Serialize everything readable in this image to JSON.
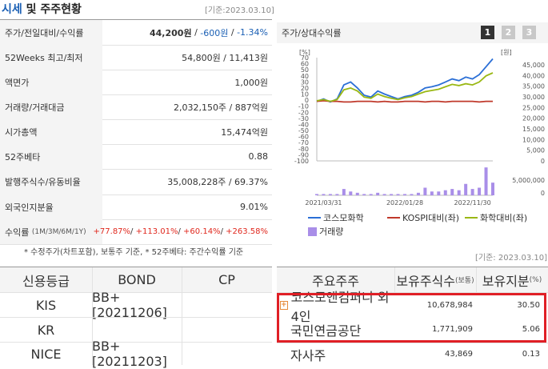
{
  "header": {
    "title_main": "시세",
    "title_rest": " 및 주주현황",
    "basis": "[기준:2023.03.10]"
  },
  "summary": [
    {
      "label": "주가/전일대비/수익률",
      "price": "44,200원",
      "change": "-600원",
      "rate": "-1.34%"
    },
    {
      "label": "52Weeks 최고/최저",
      "value": "54,800원 / 11,413원"
    },
    {
      "label": "액면가",
      "value": "1,000원"
    },
    {
      "label": "거래량/거래대금",
      "value": "2,032,150주 / 887억원"
    },
    {
      "label": "시가총액",
      "value": "15,474억원"
    },
    {
      "label": "52주베타",
      "value": "0.88"
    },
    {
      "label": "발행주식수/유동비율",
      "value": "35,008,228주 / 69.37%"
    },
    {
      "label": "외국인지분율",
      "value": "9.01%"
    }
  ],
  "returns": {
    "label": "수익률",
    "periods": "(1M/3M/6M/1Y)",
    "r1": "+77.87%",
    "r2": "+113.01%",
    "r3": "+60.14%",
    "r4": "+263.58%"
  },
  "note": "* 수정주가(차트포함), 보통주 기준, * 52주베타: 주간수익률 기준",
  "chart_panel": {
    "title": "주가/상대수익률",
    "buttons": [
      "1",
      "2",
      "3"
    ]
  },
  "chart_data": {
    "type": "line",
    "title": "",
    "left_unit": "[%]",
    "right_unit": "[원]",
    "x_ticks": [
      "2021/03/31",
      "2022/01/28",
      "2022/11/30"
    ],
    "left_ticks": [
      "70",
      "60",
      "50",
      "40",
      "30",
      "20",
      "10",
      "0",
      "-10",
      "-20",
      "-30",
      "-40",
      "-50",
      "-60",
      "-70",
      "-80",
      "-90",
      "-100"
    ],
    "right_ticks": [
      "45,000",
      "40,000",
      "35,000",
      "30,000",
      "25,000",
      "20,000",
      "15,000",
      "10,000",
      "5,000",
      "0"
    ],
    "volume_ticks": [
      "5,000,000",
      "0"
    ],
    "left_ylim": [
      -100,
      75
    ],
    "x": [
      0,
      1,
      2,
      3,
      4,
      5,
      6,
      7,
      8,
      9,
      10,
      11,
      12,
      13,
      14,
      15,
      16,
      17,
      18,
      19,
      20,
      21,
      22,
      23,
      24,
      25,
      26
    ],
    "series": [
      {
        "name": "코스모화학",
        "color": "#2b6fd6",
        "values": [
          -2,
          2,
          -3,
          2,
          25,
          30,
          20,
          8,
          5,
          15,
          10,
          6,
          2,
          6,
          8,
          13,
          20,
          22,
          25,
          30,
          35,
          32,
          38,
          35,
          42,
          55,
          68
        ]
      },
      {
        "name": "KOSPI대비(좌)",
        "color": "#c0392b",
        "values": [
          -2,
          -1,
          -2,
          -2,
          -3,
          -3,
          -2,
          -2,
          -2,
          -3,
          -2,
          -3,
          -3,
          -2,
          -2,
          -2,
          -3,
          -2,
          -2,
          -3,
          -2,
          -2,
          -2,
          -2,
          -3,
          -2,
          -2
        ]
      },
      {
        "name": "화학대비(좌)",
        "color": "#9ab814",
        "values": [
          -1,
          1,
          -2,
          1,
          17,
          20,
          15,
          5,
          3,
          10,
          6,
          3,
          1,
          4,
          6,
          10,
          14,
          16,
          18,
          22,
          26,
          24,
          27,
          25,
          30,
          40,
          45
        ]
      }
    ],
    "volume": {
      "name": "거래량",
      "color": "#a98ee8",
      "values": [
        0.1,
        0.1,
        0.1,
        0.1,
        0.5,
        0.3,
        0.2,
        0.1,
        0.1,
        0.2,
        0.1,
        0.1,
        0.1,
        0.1,
        0.1,
        0.2,
        0.6,
        0.3,
        0.3,
        0.4,
        0.5,
        0.4,
        0.9,
        0.5,
        0.6,
        2.2,
        1.0
      ]
    }
  },
  "legend": [
    {
      "name": "코스모화학",
      "type": "line",
      "color": "#2b6fd6"
    },
    {
      "name": "KOSPI대비(좌)",
      "type": "line",
      "color": "#c0392b"
    },
    {
      "name": "화학대비(좌)",
      "type": "line",
      "color": "#9ab814"
    },
    {
      "name": "거래량",
      "type": "box",
      "color": "#a98ee8"
    }
  ],
  "credit": {
    "headers": [
      "신용등급",
      "BOND",
      "CP"
    ],
    "rows": [
      {
        "agency": "KIS",
        "bond": "BB+  [20211206]",
        "cp": ""
      },
      {
        "agency": "KR",
        "bond": "",
        "cp": ""
      },
      {
        "agency": "NICE",
        "bond": "BB+  [20211203]",
        "cp": ""
      }
    ]
  },
  "shareholders": {
    "basis": "[기준: 2023.03.10]",
    "headers": {
      "col1": "주요주주",
      "col2": "보유주식수",
      "col2_sub": "(보통)",
      "col3": "보유지분",
      "col3_sub": "(%)"
    },
    "rows": [
      {
        "name": "코스모앤컴퍼니 외 4인",
        "shares": "10,678,984",
        "pct": "30.50",
        "expand": true
      },
      {
        "name": "국민연금공단",
        "shares": "1,771,909",
        "pct": "5.06",
        "expand": false
      },
      {
        "name": "자사주",
        "shares": "43,869",
        "pct": "0.13",
        "expand": false
      }
    ]
  }
}
